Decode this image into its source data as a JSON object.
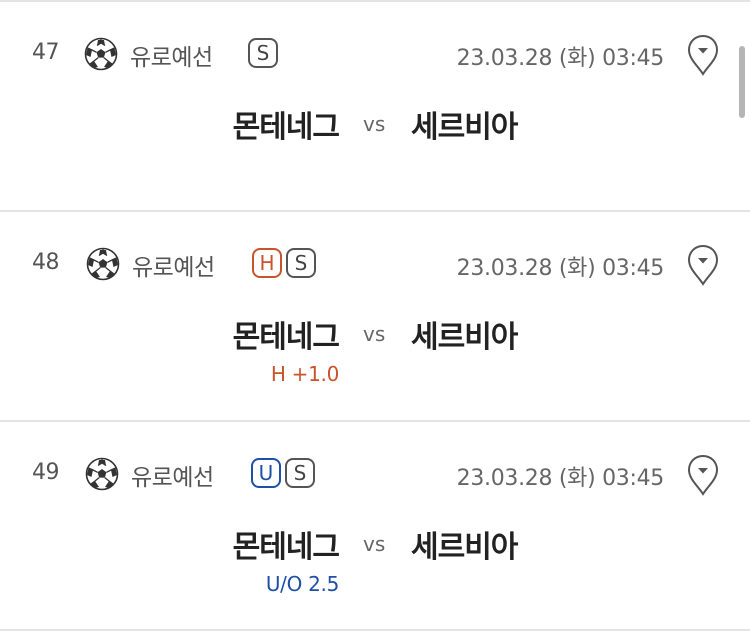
{
  "matches": [
    {
      "number": "47",
      "league": "유로예선",
      "badges": [
        {
          "label": "S",
          "kind": "special"
        }
      ],
      "datetime": "23.03.28 (화) 03:45",
      "home": "몬테네그",
      "vs": "vs",
      "away": "세르비아",
      "handicap": ""
    },
    {
      "number": "48",
      "league": "유로예선",
      "badges": [
        {
          "label": "H",
          "kind": "handicap"
        },
        {
          "label": "S",
          "kind": "special"
        }
      ],
      "datetime": "23.03.28 (화) 03:45",
      "home": "몬테네그",
      "vs": "vs",
      "away": "세르비아",
      "handicap": "H +1.0"
    },
    {
      "number": "49",
      "league": "유로예선",
      "badges": [
        {
          "label": "U",
          "kind": "under-over"
        },
        {
          "label": "S",
          "kind": "special"
        }
      ],
      "datetime": "23.03.28 (화) 03:45",
      "home": "몬테네그",
      "vs": "vs",
      "away": "세르비아",
      "handicap": "U/O 2.5"
    }
  ],
  "colors": {
    "handicap": "#c9542b",
    "under_over": "#1f4fa6",
    "special": "#555555",
    "divider": "#e4e4e4"
  },
  "icons": {
    "sport": "soccer-ball-icon",
    "location": "map-pin-icon"
  }
}
